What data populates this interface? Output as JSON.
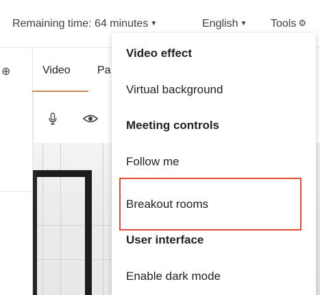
{
  "topbar": {
    "remaining_time": "Remaining time: 64 minutes",
    "language": "English",
    "tools": "Tools"
  },
  "tabs": {
    "video": "Video",
    "participants_partial": "Pa"
  },
  "menu": {
    "video_effect_header": "Video effect",
    "virtual_background": "Virtual background",
    "meeting_controls_header": "Meeting controls",
    "follow_me": "Follow me",
    "breakout_rooms": "Breakout rooms",
    "user_interface_header": "User interface",
    "enable_dark_mode": "Enable dark mode"
  },
  "icons": {
    "caret": "caret-down-icon",
    "gear": "gear-icon",
    "expand": "expand-icon",
    "mic": "microphone-icon",
    "eye": "eye-icon"
  },
  "colors": {
    "highlight_border": "#e8472f",
    "active_tab_underline": "#c68a5a",
    "text": "#202124"
  }
}
